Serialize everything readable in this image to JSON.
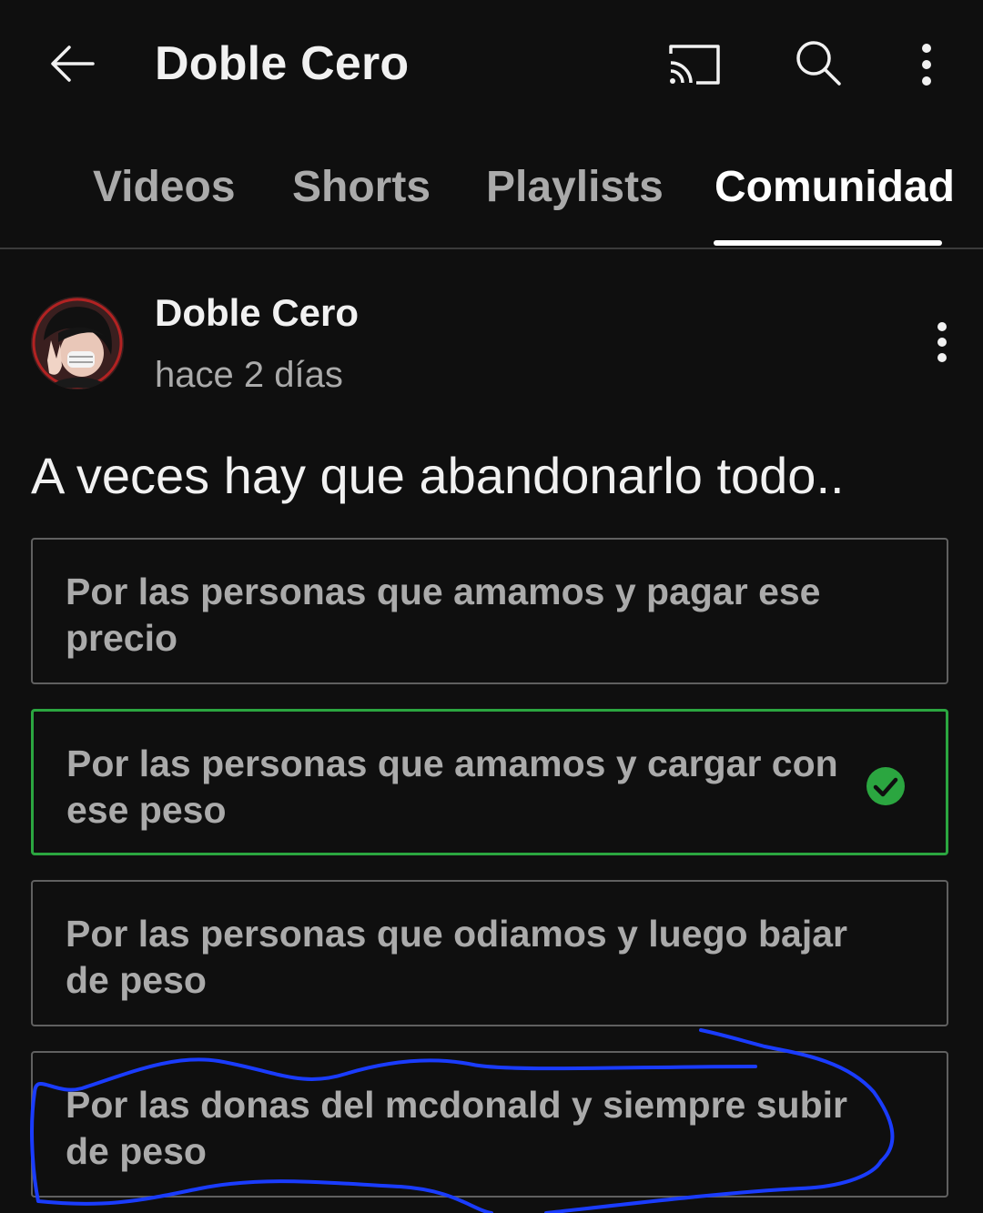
{
  "header": {
    "title": "Doble Cero",
    "icons": [
      "back-arrow-icon",
      "cast-icon",
      "search-icon",
      "more-vert-icon"
    ]
  },
  "tabs": [
    {
      "label": "Videos",
      "selected": false
    },
    {
      "label": "Shorts",
      "selected": false
    },
    {
      "label": "Playlists",
      "selected": false
    },
    {
      "label": "Comunidad",
      "selected": true
    }
  ],
  "post": {
    "author": "Doble Cero",
    "time": "hace 2 días",
    "text": "A veces hay que abandonarlo todo..",
    "options": [
      {
        "text": "Por las personas que amamos y pagar ese precio",
        "selected": false
      },
      {
        "text": "Por las personas que amamos y cargar con ese peso",
        "selected": true
      },
      {
        "text": "Por las personas que odiamos y luego bajar de peso",
        "selected": false
      },
      {
        "text": "Por las donas del mcdonald y siempre subir de peso",
        "selected": false
      }
    ]
  },
  "colors": {
    "background": "#0f0f0f",
    "selected_border": "#2ba640",
    "annotation_stroke": "#1a3cff"
  }
}
